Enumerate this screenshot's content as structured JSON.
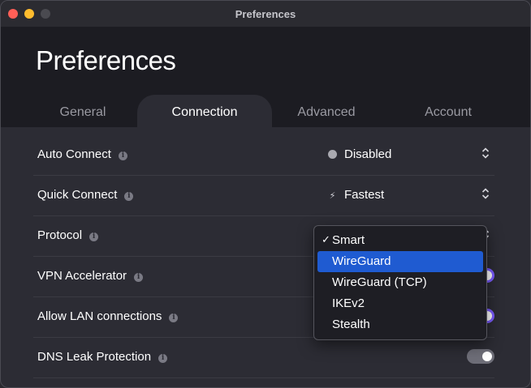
{
  "window": {
    "title": "Preferences"
  },
  "page_title": "Preferences",
  "tabs": [
    {
      "label": "General",
      "active": false
    },
    {
      "label": "Connection",
      "active": true
    },
    {
      "label": "Advanced",
      "active": false
    },
    {
      "label": "Account",
      "active": false
    }
  ],
  "rows": [
    {
      "label": "Auto Connect",
      "control": "select",
      "value": "Disabled",
      "icon": "status-dot-icon"
    },
    {
      "label": "Quick Connect",
      "control": "select",
      "value": "Fastest",
      "icon": "lightning-bolt-icon"
    },
    {
      "label": "Protocol",
      "control": "select",
      "value": "Smart",
      "open": true
    },
    {
      "label": "VPN Accelerator",
      "control": "toggle",
      "on": true
    },
    {
      "label": "Allow LAN connections",
      "control": "toggle",
      "on": true
    },
    {
      "label": "DNS Leak Protection",
      "control": "toggle",
      "on": false
    }
  ],
  "protocol_options": [
    "Smart",
    "WireGuard",
    "WireGuard (TCP)",
    "IKEv2",
    "Stealth"
  ],
  "protocol_checked": "Smart",
  "protocol_highlighted": "WireGuard",
  "colors": {
    "accent": "#7c5cff",
    "selection": "#1f5bd1",
    "close": "#ff5f57",
    "minimize": "#febc2e"
  }
}
